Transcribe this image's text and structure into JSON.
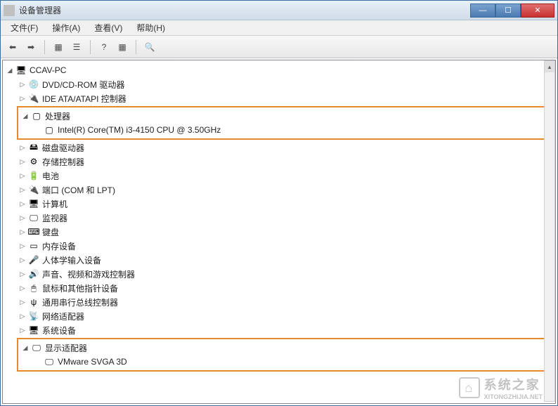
{
  "window": {
    "title": "设备管理器"
  },
  "menu": {
    "file": "文件(F)",
    "action": "操作(A)",
    "view": "查看(V)",
    "help": "帮助(H)"
  },
  "tree": {
    "root": "CCAV-PC",
    "dvd": "DVD/CD-ROM 驱动器",
    "ide": "IDE ATA/ATAPI 控制器",
    "processor": "处理器",
    "processor_item": "Intel(R) Core(TM) i3-4150 CPU @ 3.50GHz",
    "disk": "磁盘驱动器",
    "storage": "存储控制器",
    "battery": "电池",
    "ports": "端口 (COM 和 LPT)",
    "computer": "计算机",
    "monitor": "监视器",
    "keyboard": "键盘",
    "memory": "内存设备",
    "hid": "人体学输入设备",
    "sound": "声音、视频和游戏控制器",
    "mouse": "鼠标和其他指针设备",
    "usb": "通用串行总线控制器",
    "network": "网络适配器",
    "system": "系统设备",
    "display": "显示适配器",
    "display_item": "VMware SVGA 3D"
  },
  "watermark": "系统之家",
  "watermark_sub": "XITONGZHIJIA.NET"
}
